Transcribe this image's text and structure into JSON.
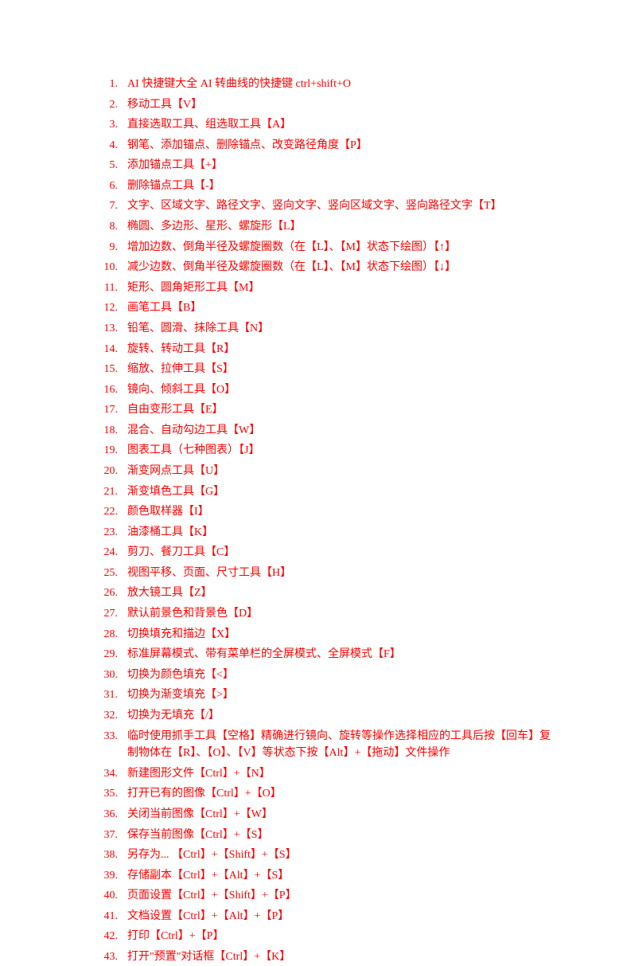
{
  "items": [
    {
      "n": "1.",
      "t": "AI  快捷键大全 AI 转曲线的快捷键    ctrl+shift+O"
    },
    {
      "n": "2.",
      "t": "移动工具【V】"
    },
    {
      "n": "3.",
      "t": "直接选取工具、组选取工具【A】"
    },
    {
      "n": "4.",
      "t": "钢笔、添加锚点、删除锚点、改变路径角度【P】"
    },
    {
      "n": "5.",
      "t": "添加锚点工具【+】"
    },
    {
      "n": "6.",
      "t": "删除锚点工具【-】"
    },
    {
      "n": "7.",
      "t": "文字、区域文字、路径文字、竖向文字、竖向区域文字、竖向路径文字【T】"
    },
    {
      "n": "8.",
      "t": "椭圆、多边形、星形、螺旋形【L】"
    },
    {
      "n": "9.",
      "t": "增加边数、倒角半径及螺旋圈数（在【L】、【M】状态下绘图）【↑】"
    },
    {
      "n": "10.",
      "t": "减少边数、倒角半径及螺旋圈数（在【L】、【M】状态下绘图）【↓】"
    },
    {
      "n": "11.",
      "t": "矩形、圆角矩形工具【M】"
    },
    {
      "n": "12.",
      "t": "画笔工具【B】"
    },
    {
      "n": "13.",
      "t": "铅笔、圆滑、抹除工具【N】"
    },
    {
      "n": "14.",
      "t": "旋转、转动工具【R】"
    },
    {
      "n": "15.",
      "t": "缩放、拉伸工具【S】"
    },
    {
      "n": "16.",
      "t": "镜向、倾斜工具【O】"
    },
    {
      "n": "17.",
      "t": "自由变形工具【E】"
    },
    {
      "n": "18.",
      "t": "混合、自动勾边工具【W】"
    },
    {
      "n": "19.",
      "t": "图表工具（七种图表）【J】"
    },
    {
      "n": "20.",
      "t": "渐变网点工具【U】"
    },
    {
      "n": "21.",
      "t": "渐变填色工具【G】"
    },
    {
      "n": "22.",
      "t": "颜色取样器【I】"
    },
    {
      "n": "23.",
      "t": "油漆桶工具【K】"
    },
    {
      "n": "24.",
      "t": "剪刀、餐刀工具【C】"
    },
    {
      "n": "25.",
      "t": "视图平移、页面、尺寸工具【H】"
    },
    {
      "n": "26.",
      "t": "放大镜工具【Z】"
    },
    {
      "n": "27.",
      "t": "默认前景色和背景色【D】"
    },
    {
      "n": "28.",
      "t": "切换填充和描边【X】"
    },
    {
      "n": "29.",
      "t": "标准屏幕模式、带有菜单栏的全屏模式、全屏模式【F】"
    },
    {
      "n": "30.",
      "t": "切换为颜色填充【<】"
    },
    {
      "n": "31.",
      "t": "切换为渐变填充【>】"
    },
    {
      "n": "32.",
      "t": "切换为无填充【/】"
    },
    {
      "n": "33.",
      "t": "临时使用抓手工具【空格】精确进行镜向、旋转等操作选择相应的工具后按【回车】复制物体在【R】、【O】、【V】等状态下按【Alt】+【拖动】文件操作"
    },
    {
      "n": "34.",
      "t": "新建图形文件【Ctrl】+【N】"
    },
    {
      "n": "35.",
      "t": "打开已有的图像【Ctrl】+【O】"
    },
    {
      "n": "36.",
      "t": "关闭当前图像【Ctrl】+【W】"
    },
    {
      "n": "37.",
      "t": "保存当前图像【Ctrl】+【S】"
    },
    {
      "n": "38.",
      "t": "另存为... 【Ctrl】+【Shift】+【S】"
    },
    {
      "n": "39.",
      "t": "存储副本【Ctrl】+【Alt】+【S】"
    },
    {
      "n": "40.",
      "t": "页面设置【Ctrl】+【Shift】+【P】"
    },
    {
      "n": "41.",
      "t": "文档设置【Ctrl】+【Alt】+【P】"
    },
    {
      "n": "42.",
      "t": "打印【Ctrl】+【P】"
    },
    {
      "n": "43.",
      "t": "打开\"预置\"对话框【Ctrl】+【K】"
    }
  ]
}
